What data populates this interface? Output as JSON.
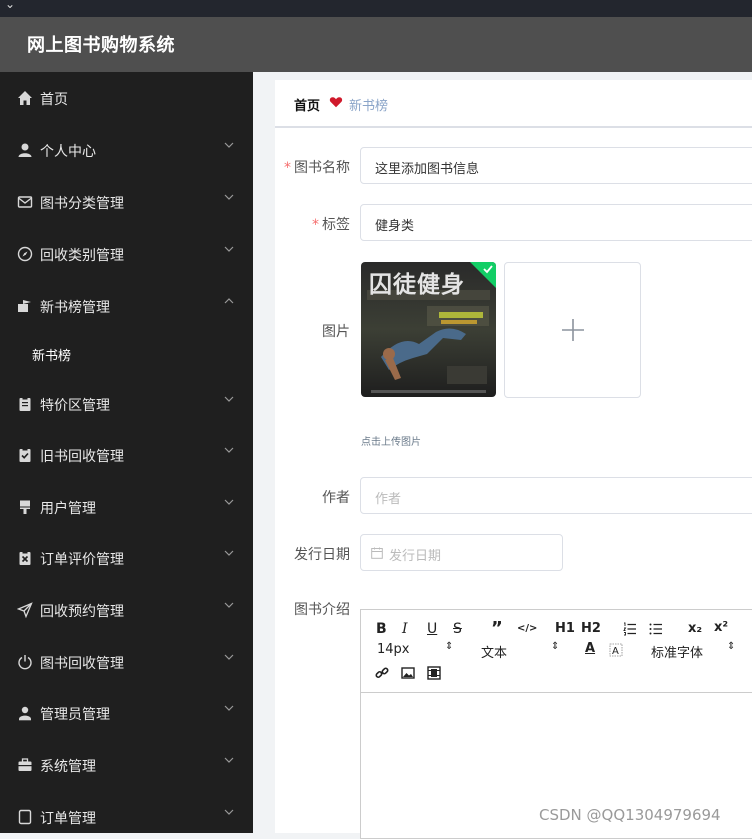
{
  "app": {
    "title": "网上图书购物系统"
  },
  "sidebar": {
    "items": [
      {
        "label": "首页",
        "icon": "home-icon",
        "expandable": false
      },
      {
        "label": "个人中心",
        "icon": "user-icon",
        "expandable": true
      },
      {
        "label": "图书分类管理",
        "icon": "mail-icon",
        "expandable": true
      },
      {
        "label": "回收类别管理",
        "icon": "compass-icon",
        "expandable": true
      },
      {
        "label": "新书榜管理",
        "icon": "flag-icon",
        "expandable": true,
        "expanded": true
      },
      {
        "label": "新书榜",
        "sub": true
      },
      {
        "label": "特价区管理",
        "icon": "clipboard-icon",
        "expandable": true
      },
      {
        "label": "旧书回收管理",
        "icon": "clipboard-check-icon",
        "expandable": true
      },
      {
        "label": "用户管理",
        "icon": "brush-icon",
        "expandable": true
      },
      {
        "label": "订单评价管理",
        "icon": "clipboard-x-icon",
        "expandable": true
      },
      {
        "label": "回收预约管理",
        "icon": "send-icon",
        "expandable": true
      },
      {
        "label": "图书回收管理",
        "icon": "power-icon",
        "expandable": true
      },
      {
        "label": "管理员管理",
        "icon": "admin-icon",
        "expandable": true
      },
      {
        "label": "系统管理",
        "icon": "briefcase-icon",
        "expandable": true
      },
      {
        "label": "订单管理",
        "icon": "document-icon",
        "expandable": true
      }
    ]
  },
  "breadcrumb": {
    "home": "首页",
    "current": "新书榜"
  },
  "form": {
    "book_name": {
      "label": "图书名称",
      "value": "这里添加图书信息",
      "required": true
    },
    "tag": {
      "label": "标签",
      "value": "健身类",
      "required": true
    },
    "image": {
      "label": "图片",
      "hint": "点击上传图片",
      "cover_text": "囚徒健身"
    },
    "author": {
      "label": "作者",
      "placeholder": "作者"
    },
    "release_date": {
      "label": "发行日期",
      "placeholder": "发行日期"
    },
    "intro": {
      "label": "图书介绍"
    }
  },
  "editor": {
    "font_size": "14px",
    "text_type": "文本",
    "font_family": "标准字体",
    "buttons": [
      "B",
      "I",
      "U",
      "S",
      "”",
      "</>",
      "H1",
      "H2",
      "ordered-list",
      "bullet-list",
      "x₂",
      "x²",
      "A",
      "background",
      "link",
      "image",
      "video"
    ]
  },
  "watermark": "CSDN @QQ1304979694",
  "colors": {
    "sidebar_bg": "#1f1f1f",
    "header_bg": "#4f4f4f",
    "required": "#f56c6c",
    "heart": "#d0192b",
    "check": "#13ce66"
  }
}
